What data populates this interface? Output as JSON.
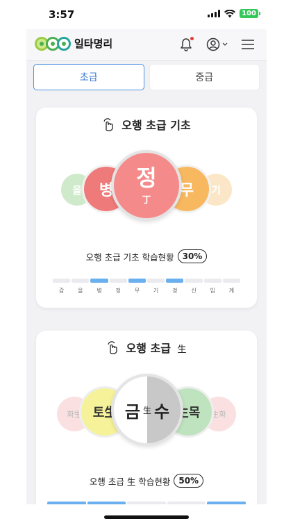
{
  "status": {
    "time": "3:57",
    "battery": "100"
  },
  "header": {
    "logo_text": "일타명리"
  },
  "tabs": [
    {
      "label": "초급",
      "active": true
    },
    {
      "label": "중급",
      "active": false
    }
  ],
  "card1": {
    "title": "오행 초급 기초",
    "balls": {
      "far_left": {
        "char": "을",
        "color": "#a8d9a0"
      },
      "left": {
        "char": "병",
        "color": "#ef7a7a"
      },
      "center": {
        "char": "정",
        "sub": "丁",
        "color": "#f58a8a"
      },
      "right": {
        "char": "무",
        "color": "#f7b860"
      },
      "far_right": {
        "char": "기",
        "color": "#f8d49a"
      }
    },
    "progress_text": "오행 초급 기초 학습현황",
    "progress_pct": "30%",
    "progress_value": 0.3,
    "segments": [
      {
        "label": "갑",
        "done": false
      },
      {
        "label": "을",
        "done": false
      },
      {
        "label": "병",
        "done": true
      },
      {
        "label": "정",
        "done": false
      },
      {
        "label": "무",
        "done": true
      },
      {
        "label": "기",
        "done": false
      },
      {
        "label": "경",
        "done": true
      },
      {
        "label": "신",
        "done": false
      },
      {
        "label": "임",
        "done": false
      },
      {
        "label": "계",
        "done": false
      }
    ]
  },
  "card2": {
    "title": "오행 초급",
    "title_suffix": "生",
    "balls": {
      "far_left": {
        "text": "화生",
        "color": "#f8d4d4"
      },
      "left": {
        "text": "토生",
        "color": "#f5f29a"
      },
      "center_left": {
        "text": "금",
        "color": "#ffffff"
      },
      "center_mid": {
        "text": "生"
      },
      "center_right": {
        "text": "수",
        "color": "#c8c8c8"
      },
      "right": {
        "text": "生목",
        "color": "#bfe3bf"
      },
      "far_right": {
        "text": "生화",
        "color": "#f8d4d4"
      }
    },
    "progress_text": "오행 초급 生 학습현황",
    "progress_pct": "50%",
    "progress_value": 0.5,
    "segments": [
      {
        "done": true
      },
      {
        "done": true
      },
      {
        "done": false
      },
      {
        "done": false
      },
      {
        "done": true
      }
    ]
  }
}
